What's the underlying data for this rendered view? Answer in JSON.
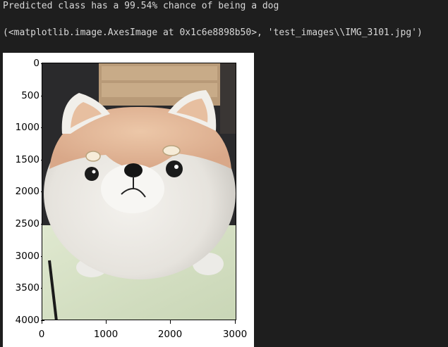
{
  "output": {
    "prediction_text": "Predicted class has a 99.54% chance of being a dog",
    "repr_text": "(<matplotlib.image.AxesImage at 0x1c6e8898b50>, 'test_images\\\\IMG_3101.jpg')"
  },
  "plot": {
    "y_ticks": [
      "0",
      "500",
      "1000",
      "1500",
      "2000",
      "2500",
      "3000",
      "3500",
      "4000"
    ],
    "x_ticks": [
      "0",
      "1000",
      "2000",
      "3000"
    ],
    "image_subject": "plush shiba inu dog toy photo"
  }
}
